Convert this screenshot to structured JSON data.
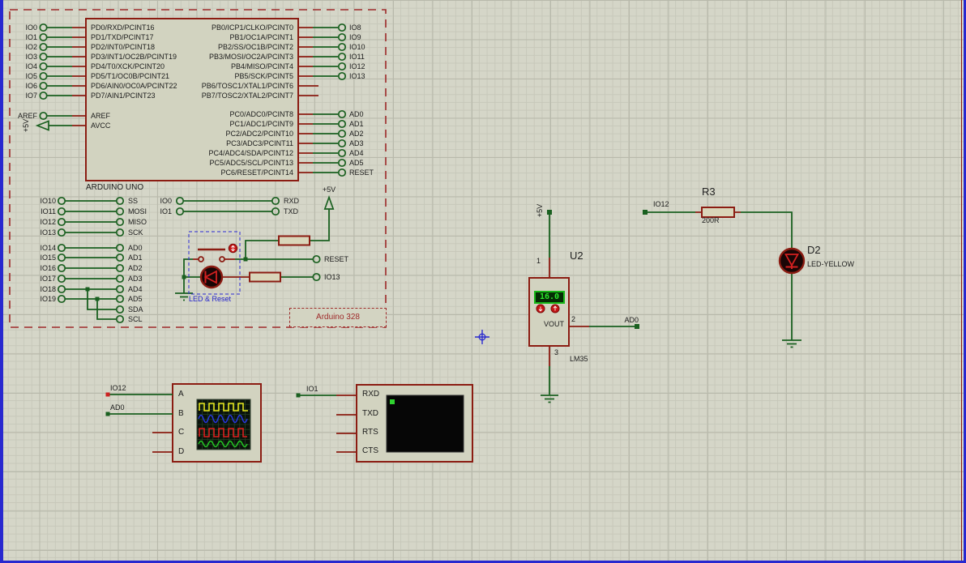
{
  "module": {
    "title": "ARDUINO UNO",
    "subtitle": "Arduino 328",
    "left_terminals": [
      "IO0",
      "IO1",
      "IO2",
      "IO3",
      "IO4",
      "IO5",
      "IO6",
      "IO7"
    ],
    "port_d_pins": [
      "PD0/RXD/PCINT16",
      "PD1/TXD/PCINT17",
      "PD2/INT0/PCINT18",
      "PD3/INT1/OC2B/PCINT19",
      "PD4/T0/XCK/PCINT20",
      "PD5/T1/OC0B/PCINT21",
      "PD6/AIN0/OC0A/PCINT22",
      "PD7/AIN1/PCINT23"
    ],
    "port_b_pins": [
      "PB0/ICP1/CLKO/PCINT0",
      "PB1/OC1A/PCINT1",
      "PB2/SS/OC1B/PCINT2",
      "PB3/MOSI/OC2A/PCINT3",
      "PB4/MISO/PCINT4",
      "PB5/SCK/PCINT5",
      "PB6/TOSC1/XTAL1/PCINT6",
      "PB7/TOSC2/XTAL2/PCINT7"
    ],
    "right_terminals": [
      "IO8",
      "IO9",
      "IO10",
      "IO11",
      "IO12",
      "IO13"
    ],
    "aref_terminal": "AREF",
    "aref_pin": "AREF",
    "avcc_pin": "AVCC",
    "avcc_power": "+5V",
    "port_c_pins": [
      "PC0/ADC0/PCINT8",
      "PC1/ADC1/PCINT9",
      "PC2/ADC2/PCINT10",
      "PC3/ADC3/PCINT11",
      "PC4/ADC4/SDA/PCINT12",
      "PC5/ADC5/SCL/PCINT13",
      "PC6/RESET/PCINT14"
    ],
    "adc_terminals": [
      "AD0",
      "AD1",
      "AD2",
      "AD3",
      "AD4",
      "AD5",
      "RESET"
    ],
    "spi_terminals": [
      "IO10",
      "IO11",
      "IO12",
      "IO13"
    ],
    "spi_nets": [
      "SS",
      "MOSI",
      "MISO",
      "SCK"
    ],
    "serial_terminals": [
      "IO0",
      "IO1"
    ],
    "serial_nets": [
      "RXD",
      "TXD"
    ],
    "analog_terminals": [
      "IO14",
      "IO15",
      "IO16",
      "IO17",
      "IO18",
      "IO19"
    ],
    "analog_nets": [
      "AD0",
      "AD1",
      "AD2",
      "AD3",
      "AD4",
      "AD5",
      "SDA",
      "SCL"
    ],
    "led_reset": {
      "caption": "LED & Reset",
      "power": "+5V",
      "reset_net": "RESET",
      "led_net": "IO13"
    }
  },
  "lm35": {
    "ref": "U2",
    "part": "LM35",
    "display": "16.0",
    "vout": "VOUT",
    "pin1": "1",
    "pin2": "2",
    "pin3": "3",
    "power": "+5V",
    "out_net": "AD0"
  },
  "r3": {
    "ref": "R3",
    "value": "200R",
    "net": "IO12"
  },
  "d2": {
    "ref": "D2",
    "part": "LED-YELLOW"
  },
  "scope": {
    "channels": [
      "A",
      "B",
      "C",
      "D"
    ],
    "ch_a_net": "IO12",
    "ch_b_net": "AD0"
  },
  "terminal": {
    "pins": [
      "RXD",
      "TXD",
      "RTS",
      "CTS"
    ],
    "rx_net": "IO1"
  },
  "colors": {
    "wire": "#1a6020",
    "component": "#8b1c12",
    "annotation": "#9e2a2a",
    "selection": "#2525cc",
    "display_digits": "#2ae52a",
    "led_body": "#190606"
  }
}
